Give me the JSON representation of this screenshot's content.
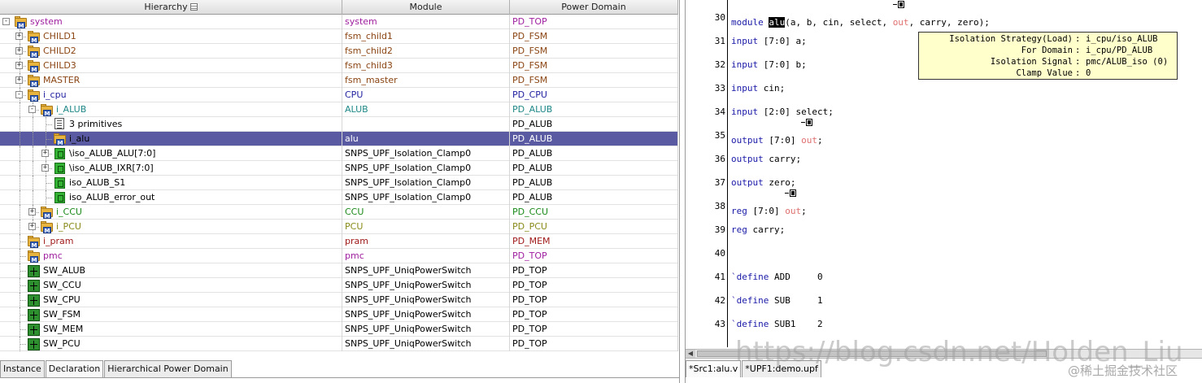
{
  "hierarchy": {
    "columns": [
      "Hierarchy",
      "Module",
      "Power Domain"
    ],
    "rows": [
      {
        "name": "system",
        "module": "system",
        "domain": "PD_TOP",
        "color": "#a020a0",
        "depth": 0,
        "expander": "-",
        "icon": "folder-m"
      },
      {
        "name": "CHILD1",
        "module": "fsm_child1",
        "domain": "PD_FSM",
        "color": "#8b4513",
        "depth": 1,
        "expander": "+",
        "icon": "folder-m"
      },
      {
        "name": "CHILD2",
        "module": "fsm_child2",
        "domain": "PD_FSM",
        "color": "#8b4513",
        "depth": 1,
        "expander": "+",
        "icon": "folder-m"
      },
      {
        "name": "CHILD3",
        "module": "fsm_child3",
        "domain": "PD_FSM",
        "color": "#8b4513",
        "depth": 1,
        "expander": "+",
        "icon": "folder-m"
      },
      {
        "name": "MASTER",
        "module": "fsm_master",
        "domain": "PD_FSM",
        "color": "#8b4513",
        "depth": 1,
        "expander": "+",
        "icon": "folder-m"
      },
      {
        "name": "i_cpu",
        "module": "CPU",
        "domain": "PD_CPU",
        "color": "#1f1fa0",
        "depth": 1,
        "expander": "-",
        "icon": "folder-m"
      },
      {
        "name": "i_ALUB",
        "module": "ALUB",
        "domain": "PD_ALUB",
        "color": "#208888",
        "depth": 2,
        "expander": "-",
        "icon": "folder-m"
      },
      {
        "name": "3 primitives",
        "module": "",
        "domain": "PD_ALUB",
        "color": "#000000",
        "depth": 3,
        "expander": "",
        "icon": "primitives"
      },
      {
        "name": "i_alu",
        "module": "alu",
        "domain": "PD_ALUB",
        "color": "#000000",
        "depth": 3,
        "expander": "",
        "icon": "folder-m",
        "selected": true
      },
      {
        "name": "\\iso_ALUB_ALU[7:0]",
        "module": "SNPS_UPF_Isolation_Clamp0",
        "domain": "PD_ALUB",
        "color": "#000000",
        "depth": 3,
        "expander": "+",
        "icon": "cell"
      },
      {
        "name": "\\iso_ALUB_IXR[7:0]",
        "module": "SNPS_UPF_Isolation_Clamp0",
        "domain": "PD_ALUB",
        "color": "#000000",
        "depth": 3,
        "expander": "+",
        "icon": "cell"
      },
      {
        "name": "iso_ALUB_S1",
        "module": "SNPS_UPF_Isolation_Clamp0",
        "domain": "PD_ALUB",
        "color": "#000000",
        "depth": 3,
        "expander": "",
        "icon": "cell"
      },
      {
        "name": "iso_ALUB_error_out",
        "module": "SNPS_UPF_Isolation_Clamp0",
        "domain": "PD_ALUB",
        "color": "#000000",
        "depth": 3,
        "expander": "",
        "icon": "cell"
      },
      {
        "name": "i_CCU",
        "module": "CCU",
        "domain": "PD_CCU",
        "color": "#1a8a1a",
        "depth": 2,
        "expander": "+",
        "icon": "folder-m"
      },
      {
        "name": "i_PCU",
        "module": "PCU",
        "domain": "PD_PCU",
        "color": "#8a8a1a",
        "depth": 2,
        "expander": "+",
        "icon": "folder-m"
      },
      {
        "name": "i_pram",
        "module": "pram",
        "domain": "PD_MEM",
        "color": "#a01a1a",
        "depth": 1,
        "expander": "",
        "icon": "folder-m"
      },
      {
        "name": "pmc",
        "module": "pmc",
        "domain": "PD_TOP",
        "color": "#a020a0",
        "depth": 1,
        "expander": "",
        "icon": "folder-m"
      },
      {
        "name": "SW_ALUB",
        "module": "SNPS_UPF_UniqPowerSwitch",
        "domain": "PD_TOP",
        "color": "#000000",
        "depth": 1,
        "expander": "",
        "icon": "switch"
      },
      {
        "name": "SW_CCU",
        "module": "SNPS_UPF_UniqPowerSwitch",
        "domain": "PD_TOP",
        "color": "#000000",
        "depth": 1,
        "expander": "",
        "icon": "switch"
      },
      {
        "name": "SW_CPU",
        "module": "SNPS_UPF_UniqPowerSwitch",
        "domain": "PD_TOP",
        "color": "#000000",
        "depth": 1,
        "expander": "",
        "icon": "switch"
      },
      {
        "name": "SW_FSM",
        "module": "SNPS_UPF_UniqPowerSwitch",
        "domain": "PD_TOP",
        "color": "#000000",
        "depth": 1,
        "expander": "",
        "icon": "switch"
      },
      {
        "name": "SW_MEM",
        "module": "SNPS_UPF_UniqPowerSwitch",
        "domain": "PD_TOP",
        "color": "#000000",
        "depth": 1,
        "expander": "",
        "icon": "switch"
      },
      {
        "name": "SW_PCU",
        "module": "SNPS_UPF_UniqPowerSwitch",
        "domain": "PD_TOP",
        "color": "#000000",
        "depth": 1,
        "expander": "",
        "icon": "switch"
      }
    ]
  },
  "left_tabs": [
    "Instance",
    "Declaration",
    "Hierarchical Power Domain"
  ],
  "source": {
    "lines": [
      {
        "num": "30",
        "parts": [
          {
            "t": "module ",
            "c": "kw"
          },
          {
            "t": "alu",
            "c": "hl"
          },
          {
            "t": "(a, b, cin, select, ",
            "c": ""
          },
          {
            "t": "out",
            "c": "sig",
            "mark": true
          },
          {
            "t": ", carry, zero);",
            "c": ""
          }
        ]
      },
      {
        "num": "31",
        "parts": [
          {
            "t": "input",
            "c": "kw"
          },
          {
            "t": " [7:0] a;",
            "c": ""
          }
        ]
      },
      {
        "num": "32",
        "parts": [
          {
            "t": "input",
            "c": "kw"
          },
          {
            "t": " [7:0] b;",
            "c": ""
          }
        ]
      },
      {
        "num": "33",
        "parts": [
          {
            "t": "input",
            "c": "kw"
          },
          {
            "t": " cin;",
            "c": ""
          }
        ]
      },
      {
        "num": "34",
        "parts": [
          {
            "t": "input",
            "c": "kw"
          },
          {
            "t": " [2:0] select;",
            "c": ""
          }
        ]
      },
      {
        "num": "35",
        "parts": [
          {
            "t": "output",
            "c": "kw"
          },
          {
            "t": " [7:0] ",
            "c": ""
          },
          {
            "t": "out",
            "c": "sig",
            "mark": true
          },
          {
            "t": ";",
            "c": ""
          }
        ]
      },
      {
        "num": "36",
        "parts": [
          {
            "t": "output",
            "c": "kw"
          },
          {
            "t": " carry;",
            "c": ""
          }
        ]
      },
      {
        "num": "37",
        "parts": [
          {
            "t": "output",
            "c": "kw"
          },
          {
            "t": " zero;",
            "c": ""
          }
        ]
      },
      {
        "num": "38",
        "parts": [
          {
            "t": "reg",
            "c": "kw"
          },
          {
            "t": " [7:0] ",
            "c": ""
          },
          {
            "t": "out",
            "c": "sig",
            "mark": true
          },
          {
            "t": ";",
            "c": ""
          }
        ]
      },
      {
        "num": "39",
        "parts": [
          {
            "t": "reg",
            "c": "kw"
          },
          {
            "t": " carry;",
            "c": ""
          }
        ]
      },
      {
        "num": "40",
        "parts": []
      },
      {
        "num": "41",
        "parts": [
          {
            "t": "`define",
            "c": "kw"
          },
          {
            "t": " ADD     0",
            "c": ""
          }
        ]
      },
      {
        "num": "42",
        "parts": [
          {
            "t": "`define",
            "c": "kw"
          },
          {
            "t": " SUB     1",
            "c": ""
          }
        ]
      },
      {
        "num": "43",
        "parts": [
          {
            "t": "`define",
            "c": "kw"
          },
          {
            "t": " SUB1    2",
            "c": ""
          }
        ]
      }
    ]
  },
  "tooltip": {
    "rows": [
      {
        "key": "Isolation Strategy(Load)",
        "value": "i_cpu/iso_ALUB"
      },
      {
        "key": "For Domain",
        "value": "i_cpu/PD_ALUB"
      },
      {
        "key": "Isolation Signal",
        "value": "pmc/ALUB_iso (0)"
      },
      {
        "key": "Clamp Value",
        "value": "0"
      }
    ]
  },
  "right_tabs": [
    "*Src1:alu.v",
    "*UPF1:demo.upf"
  ],
  "watermark": {
    "text": "https://blog.csdn.net/Holden_Liu",
    "sub": "@稀土掘金技术社区"
  },
  "colors": {
    "selection": "#5a5aa3",
    "keyword": "#1a1aa8",
    "signal": "#e07070",
    "tooltip_bg": "#ffffcc"
  }
}
